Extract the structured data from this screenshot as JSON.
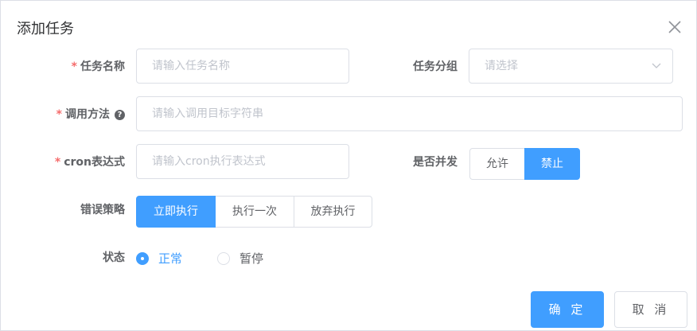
{
  "dialog": {
    "title": "添加任务",
    "close_icon": "close-icon"
  },
  "form": {
    "task_name": {
      "label": "任务名称",
      "placeholder": "请输入任务名称",
      "required_mark": "*"
    },
    "task_group": {
      "label": "任务分组",
      "placeholder": "请选择"
    },
    "invoke_method": {
      "label": "调用方法",
      "placeholder": "请输入调用目标字符串",
      "required_mark": "*",
      "help_icon": "?"
    },
    "cron": {
      "label": "cron表达式",
      "placeholder": "请输入cron执行表达式",
      "required_mark": "*"
    },
    "concurrent": {
      "label": "是否并发",
      "options": [
        "允许",
        "禁止"
      ],
      "selected": "禁止"
    },
    "misfire": {
      "label": "错误策略",
      "options": [
        "立即执行",
        "执行一次",
        "放弃执行"
      ],
      "selected": "立即执行"
    },
    "status": {
      "label": "状态",
      "options": [
        "正常",
        "暂停"
      ],
      "selected": "正常"
    }
  },
  "footer": {
    "confirm_label": "确 定",
    "cancel_label": "取 消"
  },
  "colors": {
    "primary": "#409eff",
    "required": "#f56c6c",
    "border": "#dcdfe6",
    "placeholder": "#c0c4cc"
  }
}
